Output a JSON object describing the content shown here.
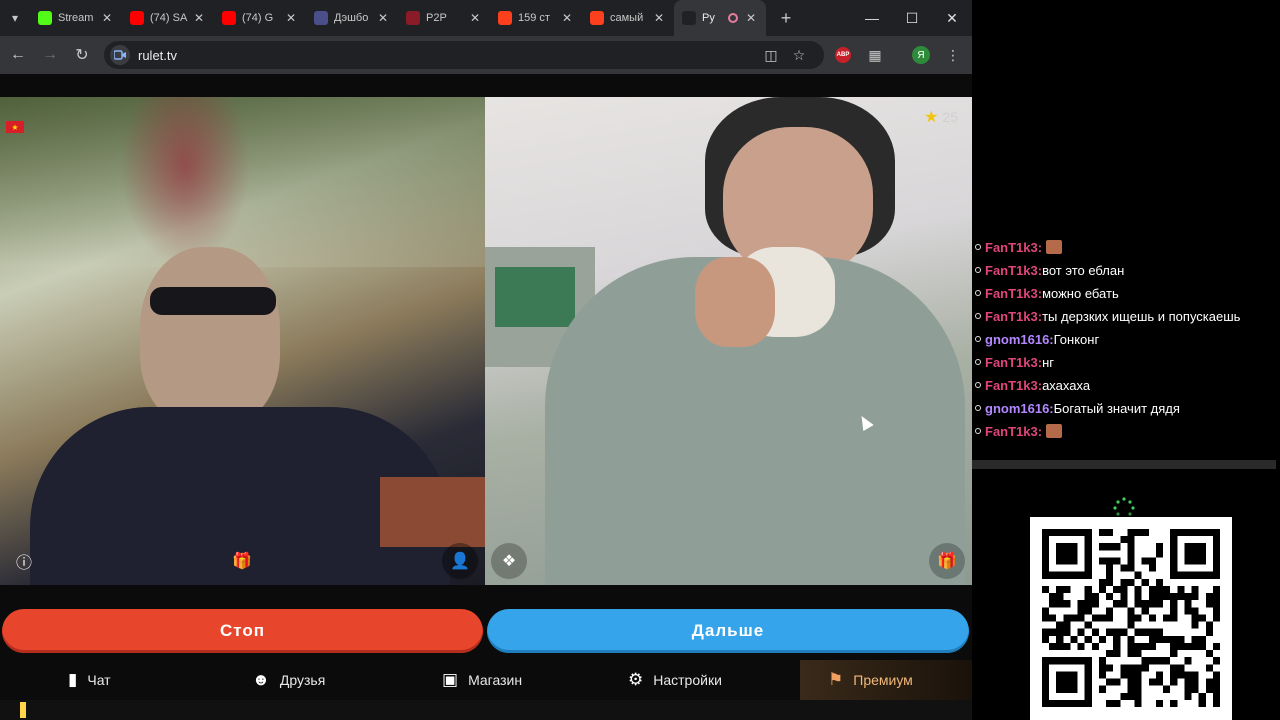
{
  "browser": {
    "tabs": [
      {
        "label": "Stream",
        "icon": "kick-icon",
        "color": "#53fc18"
      },
      {
        "label": "(74) SA",
        "icon": "youtube-icon",
        "color": "#ff0000"
      },
      {
        "label": "(74) G",
        "icon": "youtube-icon",
        "color": "#ff0000"
      },
      {
        "label": "Дэшбо",
        "icon": "dashboard-icon",
        "color": "#4a4f8a"
      },
      {
        "label": "P2P",
        "icon": "p2p-icon",
        "color": "#8a1c2a"
      },
      {
        "label": "159 ст",
        "icon": "yandex-icon",
        "color": "#fc3f1d"
      },
      {
        "label": "самый",
        "icon": "yandex-icon",
        "color": "#fc3f1d"
      },
      {
        "label": "Ру",
        "icon": "rulet-icon",
        "color": "#202124"
      }
    ],
    "url": "rulet.tv",
    "profile_letter": "Я",
    "abp_label": "ABP"
  },
  "video": {
    "star_count": "25"
  },
  "actions": {
    "stop_label": "Стоп",
    "next_label": "Дальше"
  },
  "bottom_nav": {
    "chat": "Чат",
    "friends": "Друзья",
    "shop": "Магазин",
    "settings": "Настройки",
    "premium": "Премиум"
  },
  "chat": {
    "messages": [
      {
        "user": "FanT1k3:",
        "text": "",
        "emote": true,
        "color": "#e0457b"
      },
      {
        "user": "FanT1k3:",
        "text": "вот это еблан",
        "emote": false,
        "color": "#e0457b"
      },
      {
        "user": "FanT1k3:",
        "text": "можно ебать",
        "emote": false,
        "color": "#e0457b"
      },
      {
        "user": "FanT1k3:",
        "text": "ты дерзких ищешь и попускаешь",
        "emote": false,
        "color": "#e0457b"
      },
      {
        "user": "gnom1616:",
        "text": "Гонконг",
        "emote": false,
        "color": "#b388ff"
      },
      {
        "user": "FanT1k3:",
        "text": "нг",
        "emote": false,
        "color": "#e0457b"
      },
      {
        "user": "FanT1k3:",
        "text": "ахахаха",
        "emote": false,
        "color": "#e0457b"
      },
      {
        "user": "gnom1616:",
        "text": "Богатый значит дядя",
        "emote": false,
        "color": "#b388ff"
      },
      {
        "user": "FanT1k3:",
        "text": "",
        "emote": true,
        "color": "#e0457b"
      }
    ]
  },
  "colors": {
    "stop": "#e8462c",
    "next": "#36a4ea",
    "premium": "#f0b878"
  }
}
